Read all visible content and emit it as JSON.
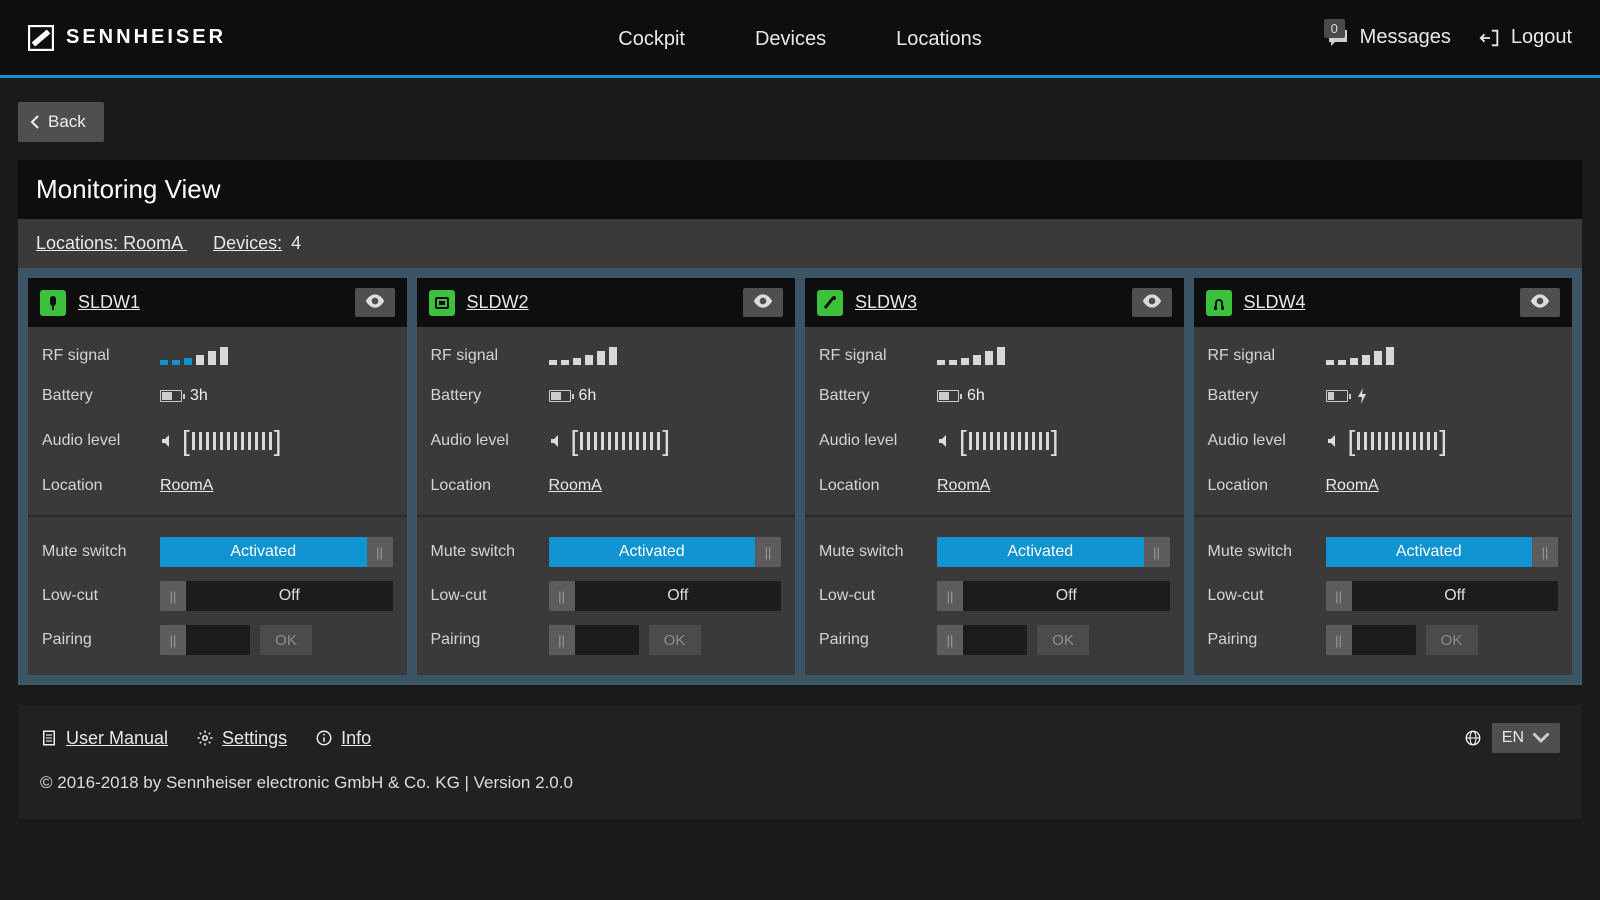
{
  "brand": "SENNHEISER",
  "nav": {
    "cockpit": "Cockpit",
    "devices": "Devices",
    "locations": "Locations"
  },
  "top": {
    "messages": "Messages",
    "msg_count": "0",
    "logout": "Logout"
  },
  "back": "Back",
  "page_title": "Monitoring View",
  "crumb": {
    "locations_label": "Locations:",
    "location_value": "RoomA",
    "devices_label": "Devices:",
    "devices_count": "4"
  },
  "labels": {
    "rf": "RF signal",
    "battery": "Battery",
    "audio": "Audio level",
    "location": "Location",
    "mute": "Mute switch",
    "lowcut": "Low-cut",
    "pairing": "Pairing",
    "ok": "OK"
  },
  "toggle_text": {
    "activated": "Activated",
    "off": "Off"
  },
  "devices": [
    {
      "name": "SLDW1",
      "battery": "3h",
      "location": "RoomA",
      "rf_on": 3,
      "charging": false,
      "mute": "Activated",
      "lowcut": "Off"
    },
    {
      "name": "SLDW2",
      "battery": "6h",
      "location": "RoomA",
      "rf_on": 0,
      "charging": false,
      "mute": "Activated",
      "lowcut": "Off"
    },
    {
      "name": "SLDW3",
      "battery": "6h",
      "location": "RoomA",
      "rf_on": 0,
      "charging": false,
      "mute": "Activated",
      "lowcut": "Off"
    },
    {
      "name": "SLDW4",
      "battery": "",
      "location": "RoomA",
      "rf_on": 0,
      "charging": true,
      "mute": "Activated",
      "lowcut": "Off"
    }
  ],
  "footer": {
    "manual": "User Manual",
    "settings": "Settings",
    "info": "Info",
    "lang": "EN",
    "copyright": "© 2016-2018 by Sennheiser electronic GmbH & Co. KG | Version 2.0.0"
  }
}
